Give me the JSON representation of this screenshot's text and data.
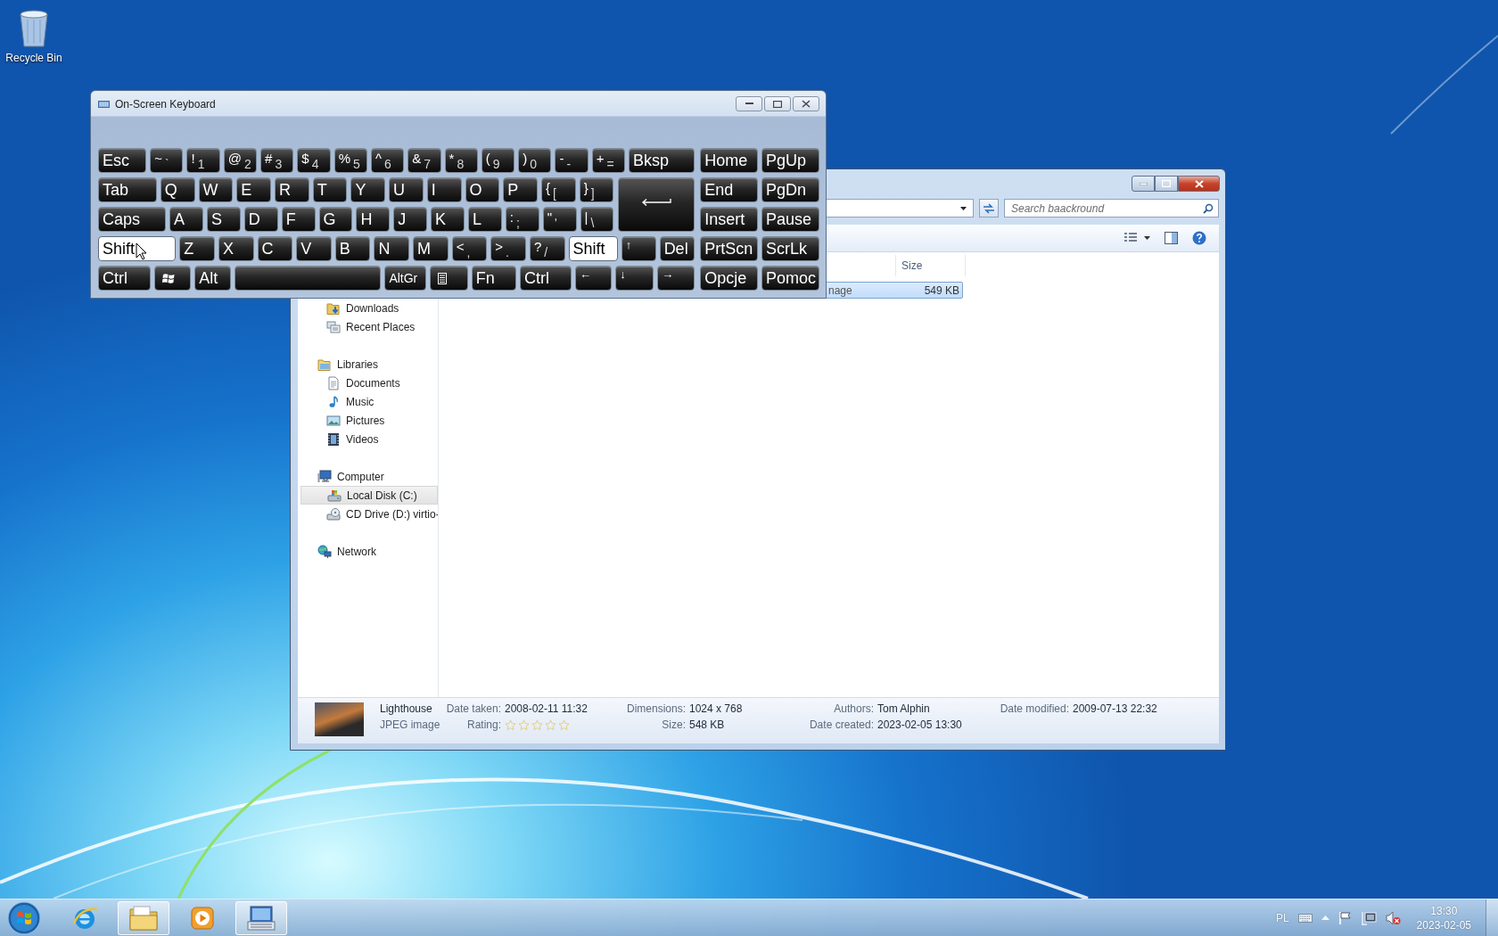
{
  "desktop": {
    "icons": [
      {
        "label": "Recycle Bin"
      }
    ]
  },
  "keyboard_window": {
    "title": "On-Screen Keyboard",
    "main_rows": [
      [
        {
          "kind": "text",
          "label": "Esc",
          "pressed": false
        },
        {
          "kind": "dual",
          "upper": "~",
          "lower": "`",
          "pressed": false
        },
        {
          "kind": "dual",
          "upper": "!",
          "lower": "1",
          "pressed": false
        },
        {
          "kind": "dual",
          "upper": "@",
          "lower": "2",
          "pressed": false
        },
        {
          "kind": "dual",
          "upper": "#",
          "lower": "3",
          "pressed": false
        },
        {
          "kind": "dual",
          "upper": "$",
          "lower": "4",
          "pressed": false
        },
        {
          "kind": "dual",
          "upper": "%",
          "lower": "5",
          "pressed": false
        },
        {
          "kind": "dual",
          "upper": "^",
          "lower": "6",
          "pressed": false
        },
        {
          "kind": "dual",
          "upper": "&",
          "lower": "7",
          "pressed": false
        },
        {
          "kind": "dual",
          "upper": "*",
          "lower": "8",
          "pressed": false
        },
        {
          "kind": "dual",
          "upper": "(",
          "lower": "9",
          "pressed": false
        },
        {
          "kind": "dual",
          "upper": ")",
          "lower": "0",
          "pressed": false
        },
        {
          "kind": "dual",
          "upper": "-",
          "lower": "-",
          "pressed": false
        },
        {
          "kind": "dual",
          "upper": "+",
          "lower": "=",
          "pressed": false
        },
        {
          "kind": "text",
          "label": "Bksp",
          "pressed": false
        }
      ],
      [
        {
          "kind": "text",
          "label": "Tab",
          "pressed": false
        },
        {
          "kind": "text",
          "label": "Q",
          "pressed": false
        },
        {
          "kind": "text",
          "label": "W",
          "pressed": false
        },
        {
          "kind": "text",
          "label": "E",
          "pressed": false
        },
        {
          "kind": "text",
          "label": "R",
          "pressed": false
        },
        {
          "kind": "text",
          "label": "T",
          "pressed": false
        },
        {
          "kind": "text",
          "label": "Y",
          "pressed": false
        },
        {
          "kind": "text",
          "label": "U",
          "pressed": false
        },
        {
          "kind": "text",
          "label": "I",
          "pressed": false
        },
        {
          "kind": "text",
          "label": "O",
          "pressed": false
        },
        {
          "kind": "text",
          "label": "P",
          "pressed": false
        },
        {
          "kind": "dual",
          "upper": "{",
          "lower": "[",
          "pressed": false
        },
        {
          "kind": "dual",
          "upper": "}",
          "lower": "]",
          "pressed": false
        },
        {
          "kind": "enter",
          "pressed": false
        }
      ],
      [
        {
          "kind": "text",
          "label": "Caps",
          "pressed": false
        },
        {
          "kind": "text",
          "label": "A",
          "pressed": false
        },
        {
          "kind": "text",
          "label": "S",
          "pressed": false
        },
        {
          "kind": "text",
          "label": "D",
          "pressed": false
        },
        {
          "kind": "text",
          "label": "F",
          "pressed": false
        },
        {
          "kind": "text",
          "label": "G",
          "pressed": false
        },
        {
          "kind": "text",
          "label": "H",
          "pressed": false
        },
        {
          "kind": "text",
          "label": "J",
          "pressed": false
        },
        {
          "kind": "text",
          "label": "K",
          "pressed": false
        },
        {
          "kind": "text",
          "label": "L",
          "pressed": false
        },
        {
          "kind": "dual",
          "upper": ":",
          "lower": ";",
          "pressed": false
        },
        {
          "kind": "dual",
          "upper": "\"",
          "lower": "'",
          "pressed": false
        },
        {
          "kind": "dual",
          "upper": "|",
          "lower": "\\",
          "pressed": false
        }
      ],
      [
        {
          "kind": "text",
          "label": "Shift",
          "pressed": true
        },
        {
          "kind": "text",
          "label": "Z",
          "pressed": false
        },
        {
          "kind": "text",
          "label": "X",
          "pressed": false
        },
        {
          "kind": "text",
          "label": "C",
          "pressed": false
        },
        {
          "kind": "text",
          "label": "V",
          "pressed": false
        },
        {
          "kind": "text",
          "label": "B",
          "pressed": false
        },
        {
          "kind": "text",
          "label": "N",
          "pressed": false
        },
        {
          "kind": "text",
          "label": "M",
          "pressed": false
        },
        {
          "kind": "dual",
          "upper": "<",
          "lower": ",",
          "pressed": false
        },
        {
          "kind": "dual",
          "upper": ">",
          "lower": ".",
          "pressed": false
        },
        {
          "kind": "dual",
          "upper": "?",
          "lower": "/",
          "pressed": false
        },
        {
          "kind": "text",
          "label": "Shift",
          "pressed": true
        },
        {
          "kind": "arrow",
          "label": "↑",
          "pressed": false
        },
        {
          "kind": "text",
          "label": "Del",
          "pressed": false
        }
      ],
      [
        {
          "kind": "text",
          "label": "Ctrl",
          "pressed": false
        },
        {
          "kind": "windows",
          "pressed": false
        },
        {
          "kind": "text",
          "label": "Alt",
          "pressed": false
        },
        {
          "kind": "space",
          "pressed": false
        },
        {
          "kind": "small",
          "label": "AltGr",
          "pressed": false
        },
        {
          "kind": "menu",
          "pressed": false
        },
        {
          "kind": "text",
          "label": "Fn",
          "pressed": false
        },
        {
          "kind": "text",
          "label": "Ctrl",
          "pressed": false
        },
        {
          "kind": "arrow",
          "label": "←",
          "pressed": false
        },
        {
          "kind": "arrow",
          "label": "↓",
          "pressed": false
        },
        {
          "kind": "arrow",
          "label": "→",
          "pressed": false
        }
      ]
    ],
    "nav_rows": [
      [
        {
          "kind": "text",
          "label": "Home",
          "pressed": false
        },
        {
          "kind": "text",
          "label": "PgUp",
          "pressed": false
        }
      ],
      [
        {
          "kind": "text",
          "label": "End",
          "pressed": false
        },
        {
          "kind": "text",
          "label": "PgDn",
          "pressed": false
        }
      ],
      [
        {
          "kind": "text",
          "label": "Insert",
          "pressed": false
        },
        {
          "kind": "text",
          "label": "Pause",
          "pressed": false
        }
      ],
      [
        {
          "kind": "text",
          "label": "PrtScn",
          "pressed": false
        },
        {
          "kind": "text",
          "label": "ScrLk",
          "pressed": false
        }
      ],
      [
        {
          "kind": "text",
          "label": "Opcje",
          "pressed": false
        },
        {
          "kind": "text",
          "label": "Pomoc",
          "pressed": false
        }
      ]
    ]
  },
  "explorer_window": {
    "search": {
      "placeholder": "Search baackround"
    },
    "columns": [
      {
        "label": "Size"
      }
    ],
    "files": [
      {
        "name": "nage",
        "size": "549 KB",
        "selected": true
      }
    ],
    "nav_pane": {
      "favorites": [
        {
          "label": "Downloads",
          "kind": "downloads",
          "selected": false
        },
        {
          "label": "Recent Places",
          "kind": "recent",
          "selected": false
        }
      ],
      "tree": [
        {
          "label": "Libraries",
          "kind": "library",
          "selected": false,
          "children": [
            {
              "label": "Documents",
              "kind": "document",
              "selected": false
            },
            {
              "label": "Music",
              "kind": "music",
              "selected": false
            },
            {
              "label": "Pictures",
              "kind": "pictures",
              "selected": false
            },
            {
              "label": "Videos",
              "kind": "videos",
              "selected": false
            }
          ]
        },
        {
          "label": "Computer",
          "kind": "computer",
          "selected": false,
          "children": [
            {
              "label": "Local Disk (C:)",
              "kind": "disk",
              "selected": true
            },
            {
              "label": "CD Drive (D:) virtio-",
              "kind": "cd",
              "selected": false
            }
          ]
        },
        {
          "label": "Network",
          "kind": "network",
          "selected": false
        }
      ]
    },
    "details_pane": {
      "name": "Lighthouse",
      "type": "JPEG image",
      "columns": [
        [
          {
            "kind": "text",
            "label": "Date taken:",
            "value": "2008-02-11 11:32"
          },
          {
            "kind": "rating",
            "label": "Rating:",
            "stars": 0
          }
        ],
        [
          {
            "kind": "text",
            "label": "Dimensions:",
            "value": "1024 x 768"
          },
          {
            "kind": "text",
            "label": "Size:",
            "value": "548 KB"
          }
        ],
        [
          {
            "kind": "text",
            "label": "Authors:",
            "value": "Tom Alphin"
          },
          {
            "kind": "text",
            "label": "Date created:",
            "value": "2023-02-05 13:30"
          }
        ],
        [
          {
            "kind": "text",
            "label": "Date modified:",
            "value": "2009-07-13 22:32"
          }
        ]
      ]
    }
  },
  "taskbar": {
    "buttons": [
      {
        "kind": "start",
        "active": false
      },
      {
        "kind": "browser",
        "active": false
      },
      {
        "kind": "folder",
        "active": true
      },
      {
        "kind": "media",
        "active": false
      },
      {
        "kind": "keyboard",
        "active": true
      }
    ],
    "tray": {
      "language": "PL",
      "time": "13:30",
      "date": "2023-02-05"
    }
  }
}
